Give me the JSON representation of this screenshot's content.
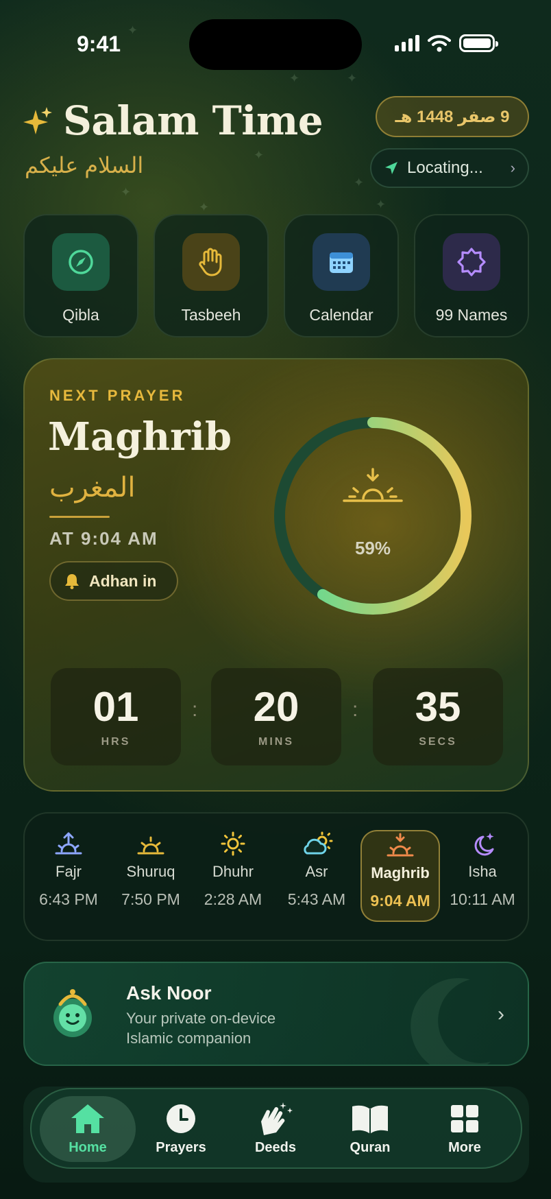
{
  "status_bar": {
    "time": "9:41"
  },
  "header": {
    "title": "Salam Time",
    "greeting_arabic": "السلام عليكم",
    "hijri_date": "9 صفر 1448 هـ",
    "location": "Locating..."
  },
  "quick_actions": [
    {
      "label": "Qibla",
      "icon": "compass-icon"
    },
    {
      "label": "Tasbeeh",
      "icon": "hand-icon"
    },
    {
      "label": "Calendar",
      "icon": "calendar-icon"
    },
    {
      "label": "99 Names",
      "icon": "star-badge-icon"
    }
  ],
  "next_prayer": {
    "label": "NEXT PRAYER",
    "name": "Maghrib",
    "name_arabic": "المغرب",
    "time": "AT 9:04 AM",
    "adhan_label": "Adhan in",
    "progress_percent": 59,
    "progress_text": "59%",
    "countdown": {
      "hours": "01",
      "hours_label": "HRS",
      "minutes": "20",
      "minutes_label": "MINS",
      "seconds": "35",
      "seconds_label": "SECS"
    }
  },
  "prayers": [
    {
      "name": "Fajr",
      "time": "6:43 PM",
      "icon": "sunrise-arrow-icon"
    },
    {
      "name": "Shuruq",
      "time": "7:50 PM",
      "icon": "sunrise-icon"
    },
    {
      "name": "Dhuhr",
      "time": "2:28 AM",
      "icon": "sun-icon"
    },
    {
      "name": "Asr",
      "time": "5:43 AM",
      "icon": "sun-cloud-icon"
    },
    {
      "name": "Maghrib",
      "time": "9:04 AM",
      "icon": "sunset-icon",
      "active": true
    },
    {
      "name": "Isha",
      "time": "10:11 AM",
      "icon": "moon-stars-icon"
    }
  ],
  "ask_noor": {
    "title": "Ask Noor",
    "subtitle_line1": "Your private on-device",
    "subtitle_line2": "Islamic companion"
  },
  "tabs": [
    {
      "label": "Home",
      "icon": "home-icon",
      "active": true
    },
    {
      "label": "Prayers",
      "icon": "clock-icon"
    },
    {
      "label": "Deeds",
      "icon": "clapping-hands-icon"
    },
    {
      "label": "Quran",
      "icon": "book-icon"
    },
    {
      "label": "More",
      "icon": "grid-icon"
    }
  ],
  "colors": {
    "accent_gold": "#e7b93d",
    "accent_green": "#55e0a2",
    "background": "#0d2619"
  }
}
